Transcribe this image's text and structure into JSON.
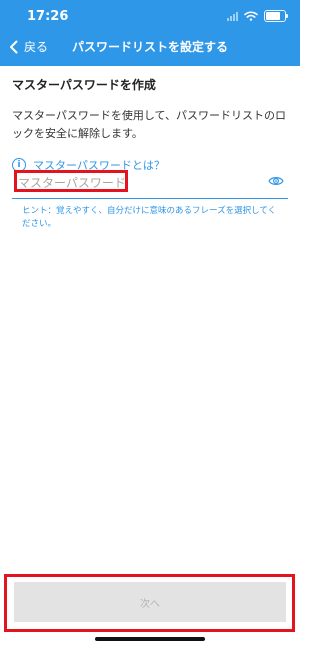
{
  "status_bar": {
    "time": "17:26",
    "battery_level": 0.85,
    "icons": [
      "signal-icon",
      "wifi-icon",
      "battery-icon"
    ]
  },
  "header": {
    "back_label": "戻る",
    "title": "パスワードリストを設定する",
    "background_color": "#2f97e8"
  },
  "main": {
    "section_title": "マスターパスワードを作成",
    "description": "マスターパスワードを使用して、パスワードリストのロックを安全に解除します。",
    "info_link": "マスターパスワードとは？",
    "password_field": {
      "placeholder": "マスターパスワード",
      "value": ""
    },
    "hint": "ヒント：覚えやすく、自分だけに意味のあるフレーズを選択してください。"
  },
  "footer": {
    "next_label": "次へ"
  },
  "colors": {
    "accent": "#2f97e8",
    "highlight": "#e4141e",
    "disabled_button": "#e3e3e3"
  }
}
